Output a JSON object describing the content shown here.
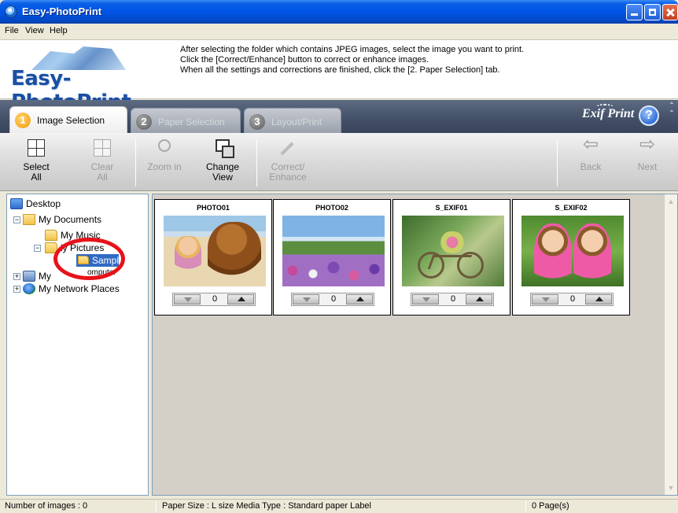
{
  "window": {
    "title": "Easy-PhotoPrint"
  },
  "menu": [
    "File",
    "View",
    "Help"
  ],
  "header": {
    "logo": "Easy-PhotoPrint",
    "instructions": [
      "After selecting the folder which contains JPEG images, select the image you want to print.",
      "Click the [Correct/Enhance] button to correct or enhance images.",
      "When all the settings and corrections are finished, click the [2. Paper Selection] tab."
    ]
  },
  "tabs": [
    {
      "num": "1",
      "label": "Image Selection",
      "active": true
    },
    {
      "num": "2",
      "label": "Paper Selection",
      "active": false
    },
    {
      "num": "3",
      "label": "Layout/Print",
      "active": false
    }
  ],
  "brand": {
    "exif": "Exif Print",
    "help": "?"
  },
  "toolbar": {
    "select_all": "Select\nAll",
    "clear_all": "Clear\nAll",
    "zoom_in": "Zoom in",
    "change_view": "Change\nView",
    "correct": "Correct/\nEnhance",
    "back": "Back",
    "next": "Next",
    "back_arrow": "⇦",
    "next_arrow": "⇨"
  },
  "tree": {
    "desktop": "Desktop",
    "my_documents": "My Documents",
    "my_music": "My Music",
    "my_pictures": "ly Pictures",
    "sample": "Sample",
    "my_computer": "My",
    "my_computer_tail": "omputer",
    "network": "My Network Places"
  },
  "thumbnails": [
    {
      "name": "PHOTO01",
      "count": "0"
    },
    {
      "name": "PHOTO02",
      "count": "0"
    },
    {
      "name": "S_EXIF01",
      "count": "0"
    },
    {
      "name": "S_EXIF02",
      "count": "0"
    }
  ],
  "status": {
    "images": "Number of images : 0",
    "paper": "Paper Size : L size  Media Type : Standard paper Label",
    "pages": "0 Page(s)"
  },
  "colors": {
    "title_bar": "#0055e5",
    "selection": "#316ac5",
    "highlight_circle": "#e8121a",
    "tab_active_badge": "#f19a0c"
  }
}
